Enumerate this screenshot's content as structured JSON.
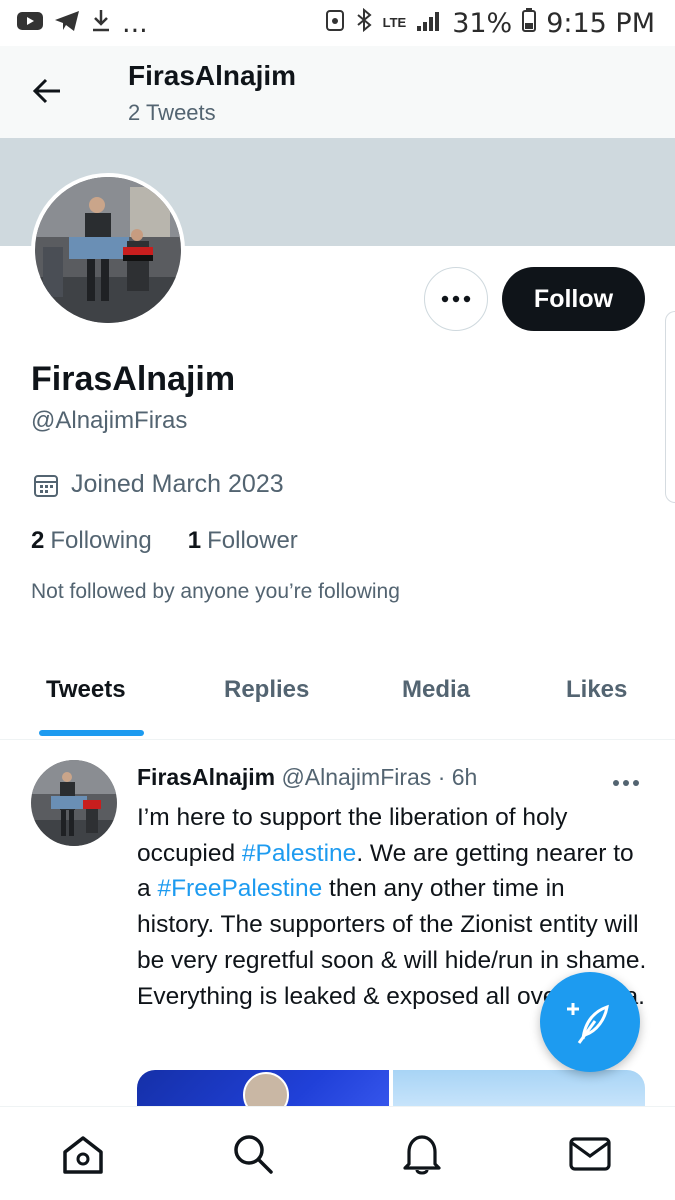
{
  "status_bar": {
    "left_icons": [
      "youtube-icon",
      "telegram-icon",
      "download-icon"
    ],
    "overflow": "...",
    "network": "LTE",
    "battery": "31%",
    "time": "9:15 PM"
  },
  "header": {
    "title": "FirasAlnajim",
    "subtitle": "2 Tweets"
  },
  "profile": {
    "display_name": "FirasAlnajim",
    "handle": "@AlnajimFiras",
    "joined": "Joined March 2023",
    "following_count": "2",
    "following_label": "Following",
    "followers_count": "1",
    "followers_label": "Follower",
    "not_followed_note": "Not followed by anyone you’re following",
    "follow_label": "Follow"
  },
  "tabs": [
    "Tweets",
    "Replies",
    "Media",
    "Likes"
  ],
  "active_tab": "Tweets",
  "tweet": {
    "author_name": "FirasAlnajim",
    "author_handle": "@AlnajimFiras",
    "separator": "·",
    "time": "6h",
    "text_1": "I’m here to support the liberation of holy occupied ",
    "hashtag_1": "#Palestine",
    "text_2": ". We are getting nearer to a ",
    "hashtag_2": "#FreePalestine",
    "text_3": " then any other time in history. The supporters of the Zionist entity will be very regretful soon & will hide/run in shame. Everything is leaked & exposed all over media."
  },
  "colors": {
    "accent": "#1d9bf0",
    "text": "#0f1419",
    "secondary_text": "#536471",
    "banner": "#cfd9de",
    "follow_button": "#0f1419"
  },
  "bottom_nav": [
    "home-icon",
    "search-icon",
    "notifications-icon",
    "messages-icon"
  ]
}
